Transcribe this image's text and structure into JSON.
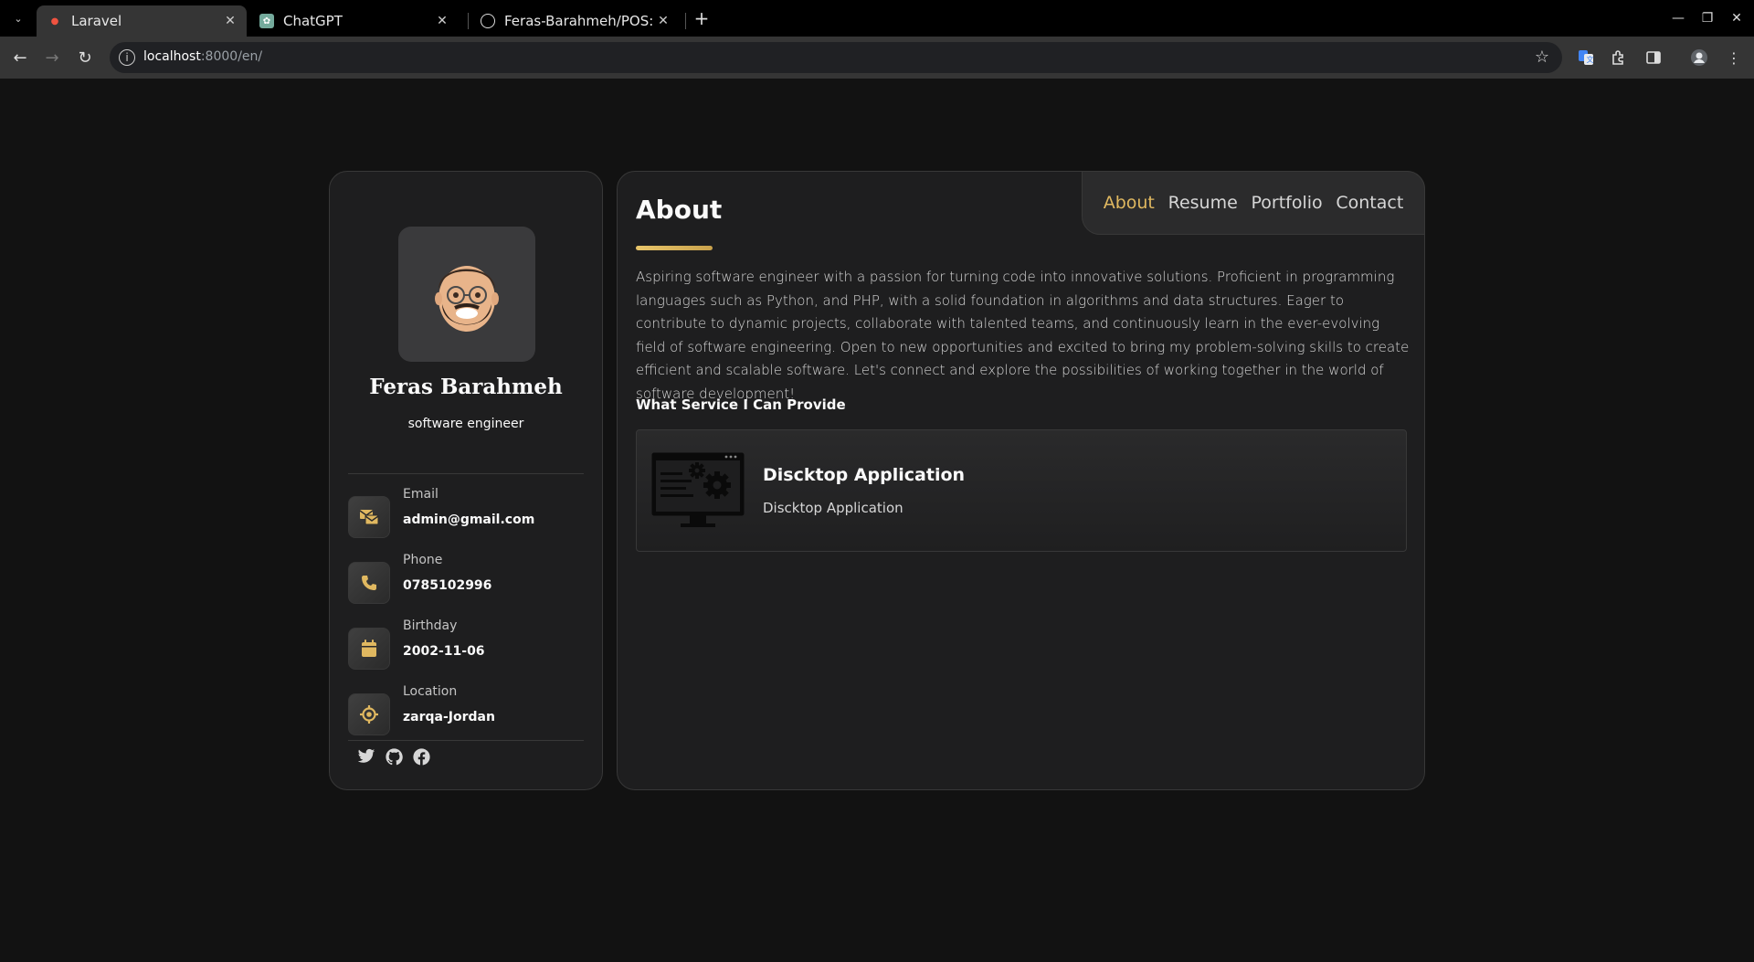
{
  "browser": {
    "tabs": [
      {
        "title": "Laravel",
        "close": "✕"
      },
      {
        "title": "ChatGPT",
        "close": "✕"
      },
      {
        "title": "Feras-Barahmeh/POS: P",
        "close": "✕"
      }
    ],
    "new_tab": "+",
    "url_host": "localhost",
    "url_path": ":8000/en/"
  },
  "profile": {
    "name": "Feras Barahmeh",
    "title": "software engineer"
  },
  "contacts": [
    {
      "label": "Email",
      "value": "admin@gmail.com",
      "icon": "mail-icon"
    },
    {
      "label": "Phone",
      "value": "0785102996",
      "icon": "phone-icon"
    },
    {
      "label": "Birthday",
      "value": "2002-11-06",
      "icon": "calendar-icon"
    },
    {
      "label": "Location",
      "value": "zarqa-Jordan",
      "icon": "location-icon"
    }
  ],
  "socials": [
    "twitter-icon",
    "github-icon",
    "facebook-icon"
  ],
  "nav": {
    "items": [
      "About",
      "Resume",
      "Portfolio",
      "Contact"
    ],
    "active": "About"
  },
  "about": {
    "title": "About",
    "text": "Aspiring software engineer with a passion for turning code into innovative solutions. Proficient in programming languages such as Python, and PHP, with a solid foundation in algorithms and data structures. Eager to contribute to dynamic projects, collaborate with talented teams, and continuously learn in the ever-evolving field of software engineering. Open to new opportunities and excited to bring my problem-solving skills to create efficient and scalable software. Let's connect and explore the possibilities of working together in the world of software development!",
    "services_heading": "What Service I Can Provide",
    "services": [
      {
        "title": "Discktop Application",
        "description": "Discktop Application"
      }
    ]
  },
  "colors": {
    "accent": "#e0b860",
    "background": "#121212",
    "card": "#1e1e1f"
  }
}
